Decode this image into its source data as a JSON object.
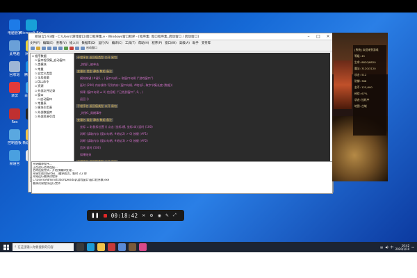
{
  "desktop": {
    "icons": [
      {
        "label": "电脑管家",
        "color": "#1d7be8"
      },
      {
        "label": "Microsoft Edge",
        "color": "#18a0d8"
      },
      {
        "label": "此电脑",
        "color": "#6aa0d8"
      },
      {
        "label": "网易UU",
        "color": "#e6d140"
      },
      {
        "label": "回收站",
        "color": "#9fb6d6"
      },
      {
        "label": "腾讯游戏",
        "color": "#1c8fe6"
      },
      {
        "label": "录屏",
        "color": "#e23a3a"
      },
      {
        "label": "百度网盘",
        "color": "#3fa6ee"
      },
      {
        "label": "Res",
        "color": "#c03030"
      },
      {
        "label": "QQ",
        "color": "#222222"
      },
      {
        "label": "控制面板",
        "color": "#5aa8e0"
      },
      {
        "label": "新建文件夹",
        "color": "#f2c44b"
      },
      {
        "label": "易语言",
        "color": "#4aa0e0"
      },
      {
        "label": "文档",
        "color": "#e8e8e8"
      }
    ]
  },
  "ide": {
    "title": "易语言5.93版 - C:\\Users\\游戏窗口\\窗口程序集.e - Windows窗口程序 - [程序集: 窗口程序集_启动窗口 / 启动窗口]",
    "menus": [
      "文件(F)",
      "编辑(E)",
      "查看(V)",
      "插入(I)",
      "数据库(D)",
      "运行(R)",
      "编译(C)",
      "工具(T)",
      "帮助(H)",
      "程序(P)",
      "窗口(W)",
      "高级(A)",
      "助手",
      "支持库"
    ],
    "toolbar_label": "启动窗口",
    "tree": [
      {
        "level": 0,
        "label": "程序数据"
      },
      {
        "level": 1,
        "label": "窗口程序集_启动窗口"
      },
      {
        "level": 1,
        "label": "类模块"
      },
      {
        "level": 1,
        "label": "常量"
      },
      {
        "level": 1,
        "label": "自定义类型"
      },
      {
        "level": 1,
        "label": "全局变量"
      },
      {
        "level": 1,
        "label": "DLL命令"
      },
      {
        "level": 1,
        "label": "资源"
      },
      {
        "level": 1,
        "label": "外部文件记录"
      },
      {
        "level": 1,
        "label": "窗口"
      },
      {
        "level": 2,
        "label": "启动窗口"
      },
      {
        "level": 1,
        "label": "常量表"
      },
      {
        "level": 1,
        "label": "模块引用表"
      },
      {
        "level": 1,
        "label": "外部数据库"
      },
      {
        "level": 1,
        "label": "外部资源引用"
      }
    ],
    "left_tabs": [
      "支持库",
      "程序",
      "属性"
    ],
    "code_lines": [
      {
        "type": "hdr",
        "text": "子程序名  返回值类型  公开  易包"
      },
      {
        "type": "row",
        "text": "_按钮1_被单击"
      },
      {
        "type": "hdr",
        "text": "变量名  类型  静态  数组  备注"
      },
      {
        "type": "row",
        "text": "模拟按键 (#键1, , )   窗口句柄 = 取窗口句柄 (“游戏窗口”)"
      },
      {
        "type": "row",
        "text": "延时 (200)   内存操作.写到内存 (窗口句柄, #地址1, 取字节集长度 (数据))"
      },
      {
        "type": "row",
        "text": "如果 (窗口句柄 ≠ 0)   信息框 (“已找到窗口”, 0, , )"
      },
      {
        "type": "row",
        "text": "返回 ()"
      },
      {
        "type": "hdr",
        "text": "子程序名  返回值类型  公开  易包"
      },
      {
        "type": "row",
        "text": "_时钟1_周期事件"
      },
      {
        "type": "hdr",
        "text": "变量名  类型  静态  数组  备注"
      },
      {
        "type": "row",
        "text": "坐标 = 取鼠标位置 ()   点击 (坐标.横, 坐标.纵)   延时 (100)"
      },
      {
        "type": "row",
        "text": "判断 (读取内存 (窗口句柄, #地址2) > 0)   按键 (#F1)"
      },
      {
        "type": "row",
        "text": "判断 (读取内存 (窗口句柄, #地址3) > 0)   按键 (#F2)"
      },
      {
        "type": "row",
        "text": "否则   延时 (500)"
      },
      {
        "type": "row",
        "text": "如果结束"
      },
      {
        "type": "hdr",
        "text": "子程序名  返回值类型  公开  易包"
      },
      {
        "type": "row",
        "text": "_启动窗口_创建完毕"
      }
    ],
    "editor_tabs": [
      "起始页",
      "_启动窗口",
      "_启动窗口",
      "_启动窗口",
      "窗口程序集",
      "窗口程序集",
      "窗口程序集_启动窗口"
    ],
    "bottom_tabs": [
      "提示",
      "输出",
      "调用表",
      "监视表",
      "变量表",
      "搜寻1",
      "搜寻2",
      "剪辑历史"
    ],
    "output_lines": [
      "开始编译程序...",
      "正在进行名称连接...",
      "名称连接完毕，开始预编译处理...",
      "开始生成目标代码... 编译成功，耗时 3.2 秒",
      "开始运行被调试程序",
      "C:\\Users\\Administrator\\Desktop\\游戏窗口\\窗口程序集.exe",
      "被调试易程序运行完毕"
    ]
  },
  "game": {
    "lines": [
      "[系统] 欢迎来到游戏",
      "等级: 45",
      "生命: 8820/8820",
      "魔法: 3120/3120",
      "攻击: 512",
      "防御: 388",
      "金币: 125,600",
      "经验: 67%",
      "状态: 挂机中",
      "地图: 古城"
    ]
  },
  "recorder": {
    "time": "00:18:42"
  },
  "taskbar": {
    "search_placeholder": "在这里输入你要搜索的内容",
    "time": "16:42",
    "date": "2020/1/10"
  }
}
